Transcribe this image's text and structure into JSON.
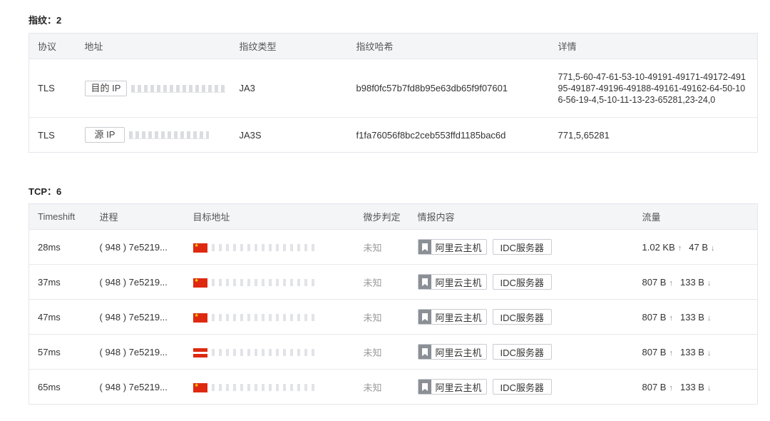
{
  "fingerprint_section": {
    "title": "指纹：2",
    "columns": [
      "协议",
      "地址",
      "指纹类型",
      "指纹哈希",
      "详情"
    ],
    "rows": [
      {
        "protocol": "TLS",
        "ip_tag": "目的 IP",
        "fp_type": "JA3",
        "fp_hash": "b98f0fc57b7fd8b95e63db65f9f07601",
        "detail": "771,5-60-47-61-53-10-49191-49171-49172-49195-49187-49196-49188-49161-49162-64-50-106-56-19-4,5-10-11-13-23-65281,23-24,0"
      },
      {
        "protocol": "TLS",
        "ip_tag": "源 IP",
        "fp_type": "JA3S",
        "fp_hash": "f1fa76056f8bc2ceb553ffd1185bac6d",
        "detail": "771,5,65281"
      }
    ]
  },
  "tcp_section": {
    "title": "TCP：6",
    "columns": [
      "Timeshift",
      "进程",
      "目标地址",
      "微步判定",
      "情报内容",
      "流量"
    ],
    "rows": [
      {
        "timeshift": "28ms",
        "process": "( 948 ) 7e5219...",
        "verdict": "未知",
        "intel_tag1": "阿里云主机",
        "intel_tag2": "IDC服务器",
        "up": "1.02 KB",
        "down": "47 B"
      },
      {
        "timeshift": "37ms",
        "process": "( 948 ) 7e5219...",
        "verdict": "未知",
        "intel_tag1": "阿里云主机",
        "intel_tag2": "IDC服务器",
        "up": "807 B",
        "down": "133 B"
      },
      {
        "timeshift": "47ms",
        "process": "( 948 ) 7e5219...",
        "verdict": "未知",
        "intel_tag1": "阿里云主机",
        "intel_tag2": "IDC服务器",
        "up": "807 B",
        "down": "133 B"
      },
      {
        "timeshift": "57ms",
        "process": "( 948 ) 7e5219...",
        "verdict": "未知",
        "intel_tag1": "阿里云主机",
        "intel_tag2": "IDC服务器",
        "up": "807 B",
        "down": "133 B"
      },
      {
        "timeshift": "65ms",
        "process": "( 948 ) 7e5219...",
        "verdict": "未知",
        "intel_tag1": "阿里云主机",
        "intel_tag2": "IDC服务器",
        "up": "807 B",
        "down": "133 B"
      }
    ]
  },
  "icons": {
    "upload": "arrow-up-icon",
    "download": "arrow-down-icon",
    "intel": "bookmark-icon",
    "flag": "cn-flag-icon"
  }
}
